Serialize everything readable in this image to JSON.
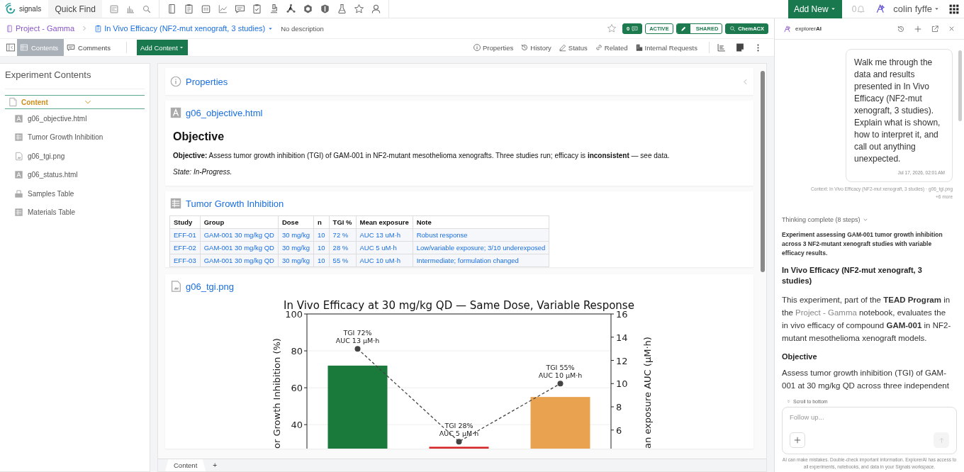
{
  "top_bar": {
    "app_name": "signals",
    "quick_find": "Quick Find",
    "add_new": "Add New",
    "notification_count": "0",
    "user_name": "colin fyffe"
  },
  "breadcrumb": {
    "project": "Project - Gamma",
    "experiment": "In Vivo Efficacy (NF2-mut xenograft, 3 studies)",
    "description": "No description"
  },
  "badges": [
    {
      "kind": "comments",
      "label": "0"
    },
    {
      "kind": "status",
      "label": "ACTIVE"
    },
    {
      "kind": "shared",
      "label": "SHARED"
    },
    {
      "kind": "search",
      "label": "ChemACX"
    }
  ],
  "view_tabs": [
    {
      "label": "Contents",
      "selected": true
    },
    {
      "label": "Comments",
      "selected": false
    }
  ],
  "add_content": "Add Content",
  "toolbar_actions": [
    {
      "kind": "info",
      "label": "Properties"
    },
    {
      "kind": "history",
      "label": "History"
    },
    {
      "kind": "pen",
      "label": "Status"
    },
    {
      "kind": "link",
      "label": "Related"
    },
    {
      "kind": "building",
      "label": "Internal Requests"
    }
  ],
  "sidebar": {
    "title": "Experiment Contents",
    "section": {
      "label": "Content",
      "expanded": true,
      "children": [
        {
          "kind": "text",
          "label": "g06_objective.html"
        },
        {
          "kind": "table",
          "label": "Tumor Growth Inhibition"
        },
        {
          "kind": "image",
          "label": "g06_tgi.png"
        },
        {
          "kind": "text",
          "label": "g06_status.html"
        },
        {
          "kind": "samples",
          "label": "Samples Table"
        },
        {
          "kind": "table",
          "label": "Materials Table"
        }
      ]
    }
  },
  "properties": {
    "title": "Properties"
  },
  "objective_entry": {
    "title": "g06_objective.html",
    "heading": "Objective",
    "body": "**Objective:** Assess tumor growth inhibition (TGI) of GAM-001 in NF2-mutant mesothelioma xenografts. Three studies run; efficacy is **inconsistent** — see data.",
    "state": "State: In-Progress."
  },
  "table_entry": {
    "title": "Tumor Growth Inhibition",
    "columns": [
      "Study",
      "Group",
      "Dose",
      "n",
      "TGI %",
      "Mean exposure",
      "Note"
    ],
    "rows": [
      [
        "EFF-01",
        "GAM-001 30 mg/kg QD",
        "30 mg/kg",
        "10",
        "72 %",
        "AUC 13 uM·h",
        "Robust response"
      ],
      [
        "EFF-02",
        "GAM-001 30 mg/kg QD",
        "30 mg/kg",
        "10",
        "28 %",
        "AUC 5 uM·h",
        "Low/variable exposure; 3/10 underexposed"
      ],
      [
        "EFF-03",
        "GAM-001 30 mg/kg QD",
        "30 mg/kg",
        "10",
        "55 %",
        "AUC 10 uM·h",
        "Intermediate; formulation changed"
      ]
    ]
  },
  "image_entry": {
    "title": "g06_tgi.png",
    "chart_data": {
      "type": "bar",
      "title": "In Vivo Efficacy at 30 mg/kg QD — Same Dose, Variable Response",
      "ylabel": "or Growth Inhibition (%)",
      "categories": [
        null,
        null,
        null
      ],
      "ylim": [
        27,
        100
      ],
      "yticks": [
        40,
        60,
        80,
        100
      ],
      "grid": true,
      "series": [
        {
          "color": "#1a7a3c",
          "values": [
            72,
            null,
            null
          ]
        },
        {
          "color": "#d62728",
          "values": [
            null,
            28,
            null
          ]
        },
        {
          "color": "#e9a24f",
          "values": [
            null,
            null,
            55
          ]
        },
        {
          "type": "line",
          "axis": "y2",
          "color": "#444444",
          "line_style": "dashed",
          "marker": "circle",
          "values": [
            13,
            5,
            10
          ]
        }
      ],
      "y2label": "an exposure AUC (µM·h)",
      "y2lim": [
        4.4,
        16
      ],
      "y2ticks": [
        6,
        8,
        10,
        12,
        14,
        16
      ],
      "value_labels": [
        [
          "TGI 72%",
          "AUC 13 µM·h"
        ],
        [
          "TGI 28%",
          "AUC 5 µM·h"
        ],
        [
          "TGI 55%",
          "AUC 10 µM·h"
        ]
      ]
    }
  },
  "bottom_tabs": [
    {
      "label": "Content",
      "selected": true
    }
  ],
  "add_tab": "+",
  "ai_panel": {
    "title": "explorer**AI**",
    "user_message": "Walk me through the data and results presented in In Vivo Efficacy (NF2-mut xenograft, 3 studies). Explain what is shown, how to interpret it, and call out anything unexpected.",
    "timestamp": "Jul 17, 2026, 02:01 AM",
    "context": "Context: In Vivo Efficacy (NF2-mut xenograft, 3 studies) · g06_tgi.png",
    "more": "+6 more",
    "thinking": "Thinking complete (8 steps)",
    "summary": "Experiment assessing GAM-001 tumor growth inhibition across 3 NF2-mutant xenograft studies with variable efficacy results.",
    "heading": "In Vivo Efficacy (NF2-mut xenograft, 3 studies)",
    "paragraph": {
      "before": "This experiment, part of the **TEAD Program** in the",
      "link": "Project - Gamma",
      "after": "notebook, evaluates the in vivo efficacy of compound **GAM-001** in NF2-mutant mesothelioma xenograft models."
    },
    "objective_heading": "Objective",
    "objective_text": "Assess tumor growth inhibition (TGI) of GAM-001 at 30 mg/kg QD across three independent",
    "scroll_to_bottom": "Scroll to bottom",
    "followup_placeholder": "Follow up...",
    "disclaimer": "AI can make mistakes. Double-check important information. ExplorerAI has access to all experiments, notebooks, and data in your Signals workspace."
  }
}
